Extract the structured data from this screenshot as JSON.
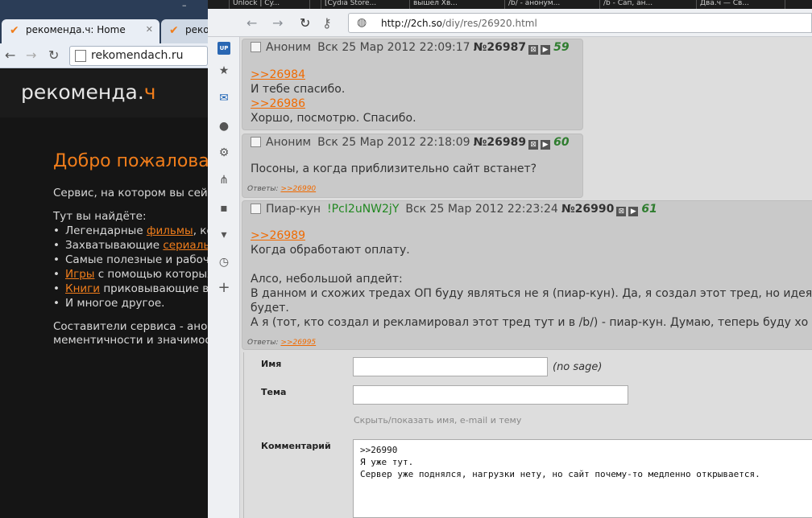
{
  "left_browser": {
    "tabs": [
      {
        "label": "рекоменда.ч: Home",
        "active": true
      },
      {
        "label": "реко",
        "active": false
      }
    ],
    "window_controls": "–",
    "address": "rekomendach.ru",
    "logo": {
      "text": "рекоменда.",
      "accent": "ч"
    },
    "heading": "Добро пожалова",
    "intro": "Сервис, на котором вы сейча",
    "list_title": "Тут вы найдёте:",
    "items": [
      {
        "pre": "Легендарные ",
        "link": "фильмы",
        "post": ", кот"
      },
      {
        "pre": "Захватывающие ",
        "link": "сериалы",
        "post": ","
      },
      {
        "pre": "Самые полезные и рабочи",
        "link": "",
        "post": ""
      },
      {
        "pre": "",
        "link": "Игры",
        "post": " с помощью которых"
      },
      {
        "pre": "",
        "link": "Книги",
        "post": " приковывающие вни"
      },
      {
        "pre": "И многое другое.",
        "link": "",
        "post": ""
      }
    ],
    "footer_line1": "Составители сервиса - анон",
    "footer_line2": "мементичности и значимост"
  },
  "right_browser": {
    "tabs": [
      "Unlock | Cy...",
      "",
      "[Cydia Store...",
      "вышел Хв...",
      "/b/ - анонум...",
      "/b - Сап, ан...",
      "Два.ч — Св...",
      ""
    ],
    "url_host": "http://2ch.so",
    "url_path": "/diy/res/26920.html",
    "sidebar_icons": [
      "up-icon",
      "star-icon",
      "mail-icon",
      "person-icon",
      "gear-icon",
      "share-icon",
      "note-icon",
      "pocket-icon",
      "clock-icon",
      "plus-icon"
    ],
    "sidebar_up_label": "UP"
  },
  "posts": [
    {
      "name": "Аноним",
      "trip": "",
      "date": "Вск 25 Мар 2012 22:09:17",
      "number": "№26987",
      "count": "59",
      "lines": [
        {
          "type": "link",
          "text": ">>26984"
        },
        {
          "type": "text",
          "text": "И тебе спасибо."
        },
        {
          "type": "link",
          "text": ">>26986"
        },
        {
          "type": "text",
          "text": "Хоршо, посмотрю. Спасибо."
        }
      ],
      "replies_label": "",
      "replies_link": ""
    },
    {
      "name": "Аноним",
      "trip": "",
      "date": "Вск 25 Мар 2012 22:18:09",
      "number": "№26989",
      "count": "60",
      "lines": [
        {
          "type": "text",
          "text": "Посоны, а когда приблизительно сайт встанет?"
        }
      ],
      "replies_label": "Ответы:",
      "replies_link": ">>26990"
    },
    {
      "name": "Пиар-кун",
      "trip": "!PcI2uNW2jY",
      "date": "Вск 25 Мар 2012 22:23:24",
      "number": "№26990",
      "count": "61",
      "lines": [
        {
          "type": "link",
          "text": ">>26989"
        },
        {
          "type": "text",
          "text": "Когда обработают оплату."
        },
        {
          "type": "text",
          "text": "Алсо, небольшой апдейт:"
        },
        {
          "type": "text",
          "text": "В данном и схожих тредах ОП буду являться не я (пиар-кун). Да, я создал этот тред, но идея"
        },
        {
          "type": "text",
          "text": "будет."
        },
        {
          "type": "text",
          "text": "А я (тот, кто создал и рекламировал этот тред тут и в /b/) - пиар-кун. Думаю, теперь буду хо"
        }
      ],
      "replies_label": "Ответы:",
      "replies_link": ">>26995"
    }
  ],
  "form": {
    "name_label": "Имя",
    "name_value": "",
    "sage_hint": "(no sage)",
    "subject_label": "Тема",
    "subject_value": "",
    "toggle_text": "Скрыть/показать имя, e-mail и тему",
    "comment_label": "Комментарий",
    "comment_text": ">>26990\nЯ уже тут.\nСервер уже поднялся, нагрузки нету, но сайт почему-то медленно открывается."
  },
  "icons": {
    "check": "✔",
    "close": "✕",
    "back": "←",
    "forward": "→",
    "reload": "↻",
    "key": "⚷",
    "globe": "◍",
    "star": "★",
    "mail": "✉",
    "person": "●",
    "gear": "⚙",
    "share": "⋔",
    "note": "▪",
    "pocket": "▾",
    "clock": "◷",
    "plus": "+",
    "hide": "⊠",
    "play": "▶",
    "bullet": "•"
  },
  "colors": {
    "accent": "#f07d1b",
    "link": "#f06a00",
    "trip": "#228822",
    "count": "#2f7d2f"
  }
}
